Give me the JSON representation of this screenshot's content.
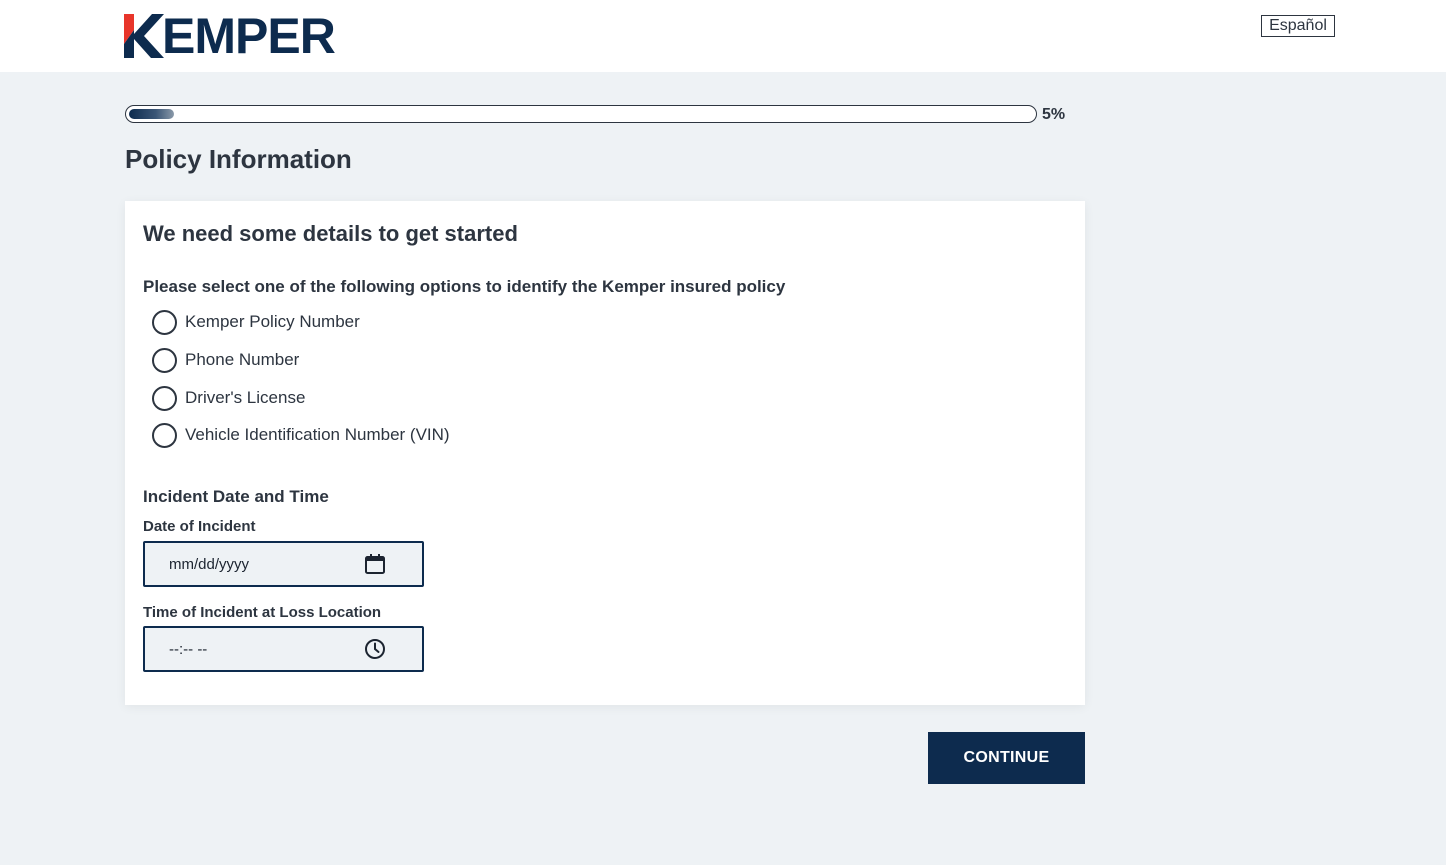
{
  "header": {
    "logo_text": "KEMPER",
    "language_button": "Español"
  },
  "progress": {
    "percent": 5,
    "label": "5%"
  },
  "page_title": "Policy Information",
  "card": {
    "heading": "We need some details to get started",
    "question": "Please select one of the following options to identify the Kemper insured policy",
    "options": [
      "Kemper Policy Number",
      "Phone Number",
      "Driver's License",
      "Vehicle Identification Number (VIN)"
    ],
    "section_title": "Incident Date and Time",
    "date_label": "Date of Incident",
    "date_placeholder": "mm/dd/yyyy",
    "time_label": "Time of Incident at Loss Location",
    "time_placeholder": "--:-- --"
  },
  "continue_label": "CONTINUE",
  "colors": {
    "brand_navy": "#0d2b4e",
    "brand_red": "#e8352a",
    "page_background": "#eef2f5"
  },
  "icons": {
    "date_field": "calendar-icon",
    "time_field": "clock-icon"
  }
}
